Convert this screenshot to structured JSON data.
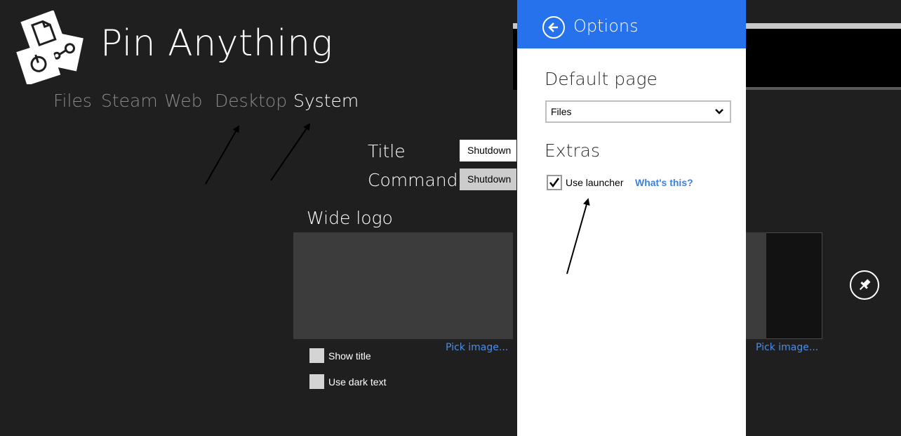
{
  "app": {
    "title": "Pin Anything"
  },
  "tabs": [
    {
      "label": "Files",
      "active": false
    },
    {
      "label": "Steam",
      "active": false
    },
    {
      "label": "Web",
      "active": false
    },
    {
      "label": "Desktop",
      "active": false
    },
    {
      "label": "System",
      "active": true
    }
  ],
  "form": {
    "title_label": "Title",
    "title_value": "Shutdown",
    "command_label": "Command",
    "command_value": "Shutdown",
    "wide_logo_label": "Wide logo",
    "pick_image_label": "Pick image...",
    "show_title_label": "Show title",
    "show_title_checked": false,
    "use_dark_text_label": "Use dark text",
    "use_dark_text_checked": false
  },
  "options_panel": {
    "title": "Options",
    "default_page_label": "Default page",
    "default_page_value": "Files",
    "extras_label": "Extras",
    "use_launcher_label": "Use launcher",
    "use_launcher_checked": true,
    "whats_this_label": "What's this?"
  },
  "colors": {
    "background": "#1f1f1f",
    "accent": "#2672ec",
    "link": "#4b8de8",
    "inactive_tab": "#8a8a8a"
  },
  "icons": {
    "logo": "pin-anything-logo-icon",
    "back": "back-arrow-icon",
    "dropdown": "chevron-down-icon",
    "check": "checkmark-icon",
    "pin": "pin-icon"
  }
}
